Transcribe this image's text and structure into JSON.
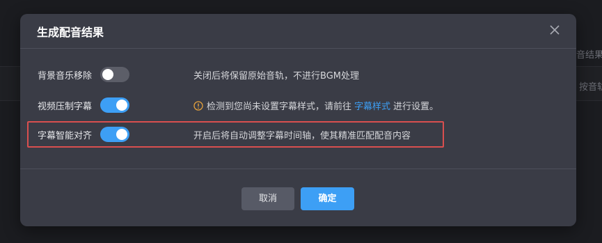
{
  "background": {
    "partial_text_1": "音结果",
    "partial_text_2": "按音轨"
  },
  "dialog": {
    "title": "生成配音结果",
    "close_icon": "close-icon",
    "rows": [
      {
        "label": "背景音乐移除",
        "toggle_state": "off",
        "description": "关闭后将保留原始音轨，不进行BGM处理"
      },
      {
        "label": "视频压制字幕",
        "toggle_state": "on",
        "warning_icon": "warning-circle-icon",
        "description_before": "检测到您尚未设置字幕样式，请前往",
        "link_text": "字幕样式",
        "description_after": "进行设置。"
      },
      {
        "label": "字幕智能对齐",
        "toggle_state": "on",
        "description": "开启后将自动调整字幕时间轴，使其精准匹配配音内容"
      }
    ],
    "buttons": {
      "cancel": "取消",
      "confirm": "确定"
    }
  },
  "colors": {
    "accent": "#3d9ff5",
    "dialog_bg": "#3a3c46",
    "highlight_border": "#d94f4f",
    "warning": "#e6a23c"
  }
}
